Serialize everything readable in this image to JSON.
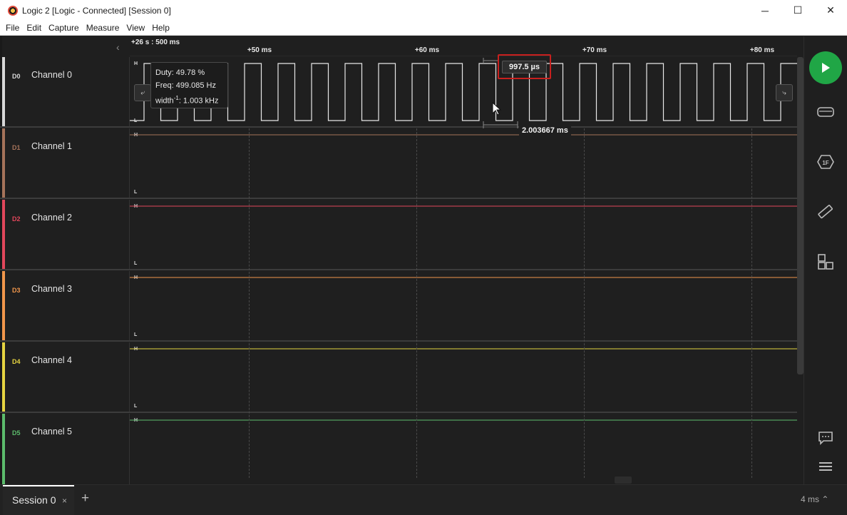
{
  "window": {
    "title": "Logic 2 [Logic - Connected] [Session 0]",
    "minimize": "─",
    "maximize": "☐",
    "close": "✕"
  },
  "menu": [
    "File",
    "Edit",
    "Capture",
    "Measure",
    "View",
    "Help"
  ],
  "timeline": {
    "origin": "+26 s : 500 ms",
    "ticks": [
      "+50 ms",
      "+60 ms",
      "+70 ms",
      "+80 ms"
    ]
  },
  "channels": [
    {
      "id": "D0",
      "name": "Channel 0",
      "color": "#d8d8d8",
      "h": "H",
      "l": "L"
    },
    {
      "id": "D1",
      "name": "Channel 1",
      "color": "#a5735a",
      "h": "H",
      "l": "L"
    },
    {
      "id": "D2",
      "name": "Channel 2",
      "color": "#e2475b",
      "h": "H",
      "l": "L"
    },
    {
      "id": "D3",
      "name": "Channel 3",
      "color": "#f1964b",
      "h": "H",
      "l": "L"
    },
    {
      "id": "D4",
      "name": "Channel 4",
      "color": "#e6d441",
      "h": "H",
      "l": "L"
    },
    {
      "id": "D5",
      "name": "Channel 5",
      "color": "#5cbc6c",
      "h": "H",
      "l": "L"
    }
  ],
  "measurement": {
    "duty": "Duty: 49.78 %",
    "freq": "Freq: 499.085 Hz",
    "width_label": "width",
    "width_sup": "-1",
    "width_value": ": 1.003 kHz"
  },
  "pulse_width": "997.5 µs",
  "period": "2.003667 ms",
  "session": {
    "tab_label": "Session 0",
    "close": "×",
    "add": "+"
  },
  "zoom": "4 ms ⌃",
  "icons": {
    "play": "play-icon",
    "device": "device-icon",
    "analyzers": "analyzers-icon",
    "measure": "ruler-icon",
    "extensions": "extensions-icon",
    "chat": "chat-icon",
    "menu": "menu-icon"
  }
}
